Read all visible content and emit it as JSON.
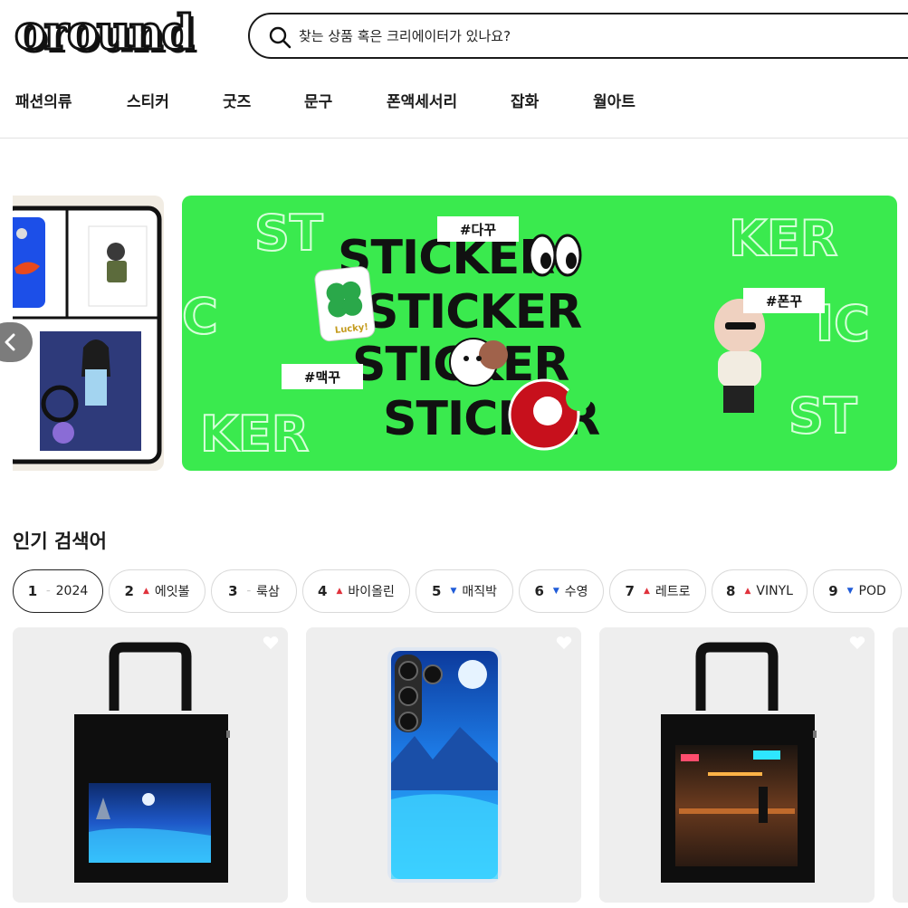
{
  "header": {
    "logo_text": "oround",
    "search_placeholder": "찾는 상품 혹은 크리에이터가 있나요?"
  },
  "nav": {
    "items": [
      "패션의류",
      "스티커",
      "굿즈",
      "문구",
      "폰액세서리",
      "잡화",
      "월아트"
    ]
  },
  "banner": {
    "tags": [
      "#다꾸",
      "#폰꾸",
      "#맥꾸"
    ],
    "headline_rows": [
      "STICKER",
      "STICKER",
      "STICKER",
      "STICKER"
    ],
    "bg_words": [
      "ST",
      "KER",
      "IC",
      "IC",
      "KER",
      "ST"
    ],
    "badge_text": "Lucky!"
  },
  "popular": {
    "title": "인기 검색어",
    "keywords": [
      {
        "rank": "1",
        "trend": "same",
        "term": "2024"
      },
      {
        "rank": "2",
        "trend": "up",
        "term": "에잇볼"
      },
      {
        "rank": "3",
        "trend": "same",
        "term": "룩삼"
      },
      {
        "rank": "4",
        "trend": "up",
        "term": "바이올린"
      },
      {
        "rank": "5",
        "trend": "down",
        "term": "매직박"
      },
      {
        "rank": "6",
        "trend": "down",
        "term": "수영"
      },
      {
        "rank": "7",
        "trend": "up",
        "term": "레트로"
      },
      {
        "rank": "8",
        "trend": "up",
        "term": "VINYL"
      },
      {
        "rank": "9",
        "trend": "down",
        "term": "POD"
      }
    ]
  },
  "products": [
    {
      "type": "tote-bag",
      "theme": "moonlit-water"
    },
    {
      "type": "phone-case",
      "theme": "moonlit-water"
    },
    {
      "type": "tote-bag",
      "theme": "neon-city"
    }
  ],
  "colors": {
    "banner_green": "#3aea4e",
    "trend_up": "#e0323c",
    "trend_down": "#1f5bd8"
  }
}
